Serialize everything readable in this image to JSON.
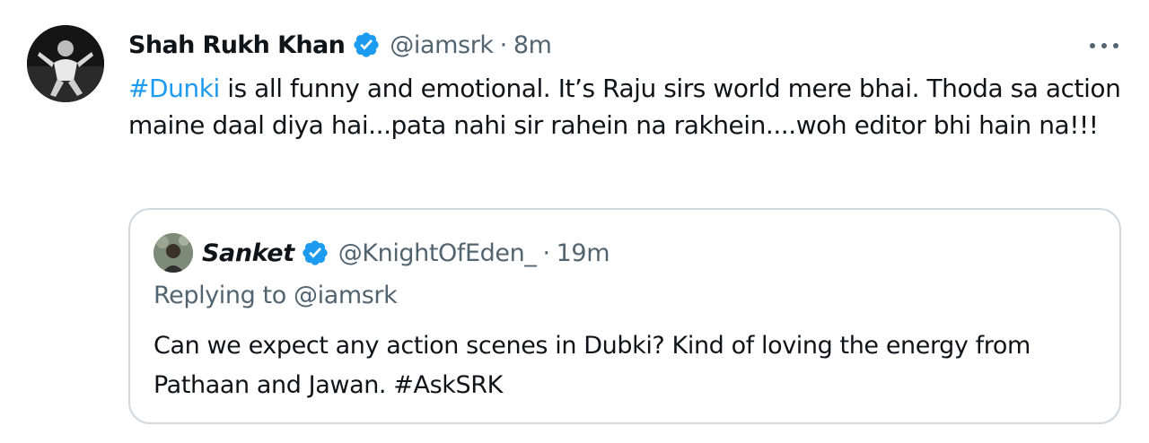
{
  "tweet": {
    "author_name": "Shah Rukh Khan",
    "handle": "@iamsrk",
    "separator": "·",
    "time": "8m",
    "verified_icon": "verified-badge-icon",
    "more_icon": "more-horizontal-icon",
    "text": {
      "hashtag": "#Dunki",
      "body": " is all funny and emotional. It’s Raju sirs world mere bhai. Thoda sa action maine daal diya hai...pata nahi sir rahein na rakhein....woh editor bhi hain na!!!"
    }
  },
  "quote": {
    "author_name": "Sanket",
    "handle": "@KnightOfEden_",
    "separator": "·",
    "time": "19m",
    "verified_icon": "verified-badge-icon",
    "replying_to": "Replying to @iamsrk",
    "text": "Can we expect any action scenes in Dubki? Kind of loving the energy from Pathaan and Jawan. #AskSRK"
  },
  "colors": {
    "link": "#1d9bf0",
    "secondary_text": "#536471",
    "primary_text": "#0f1419",
    "border": "#cfd9de",
    "verified": "#1d9bf0"
  }
}
